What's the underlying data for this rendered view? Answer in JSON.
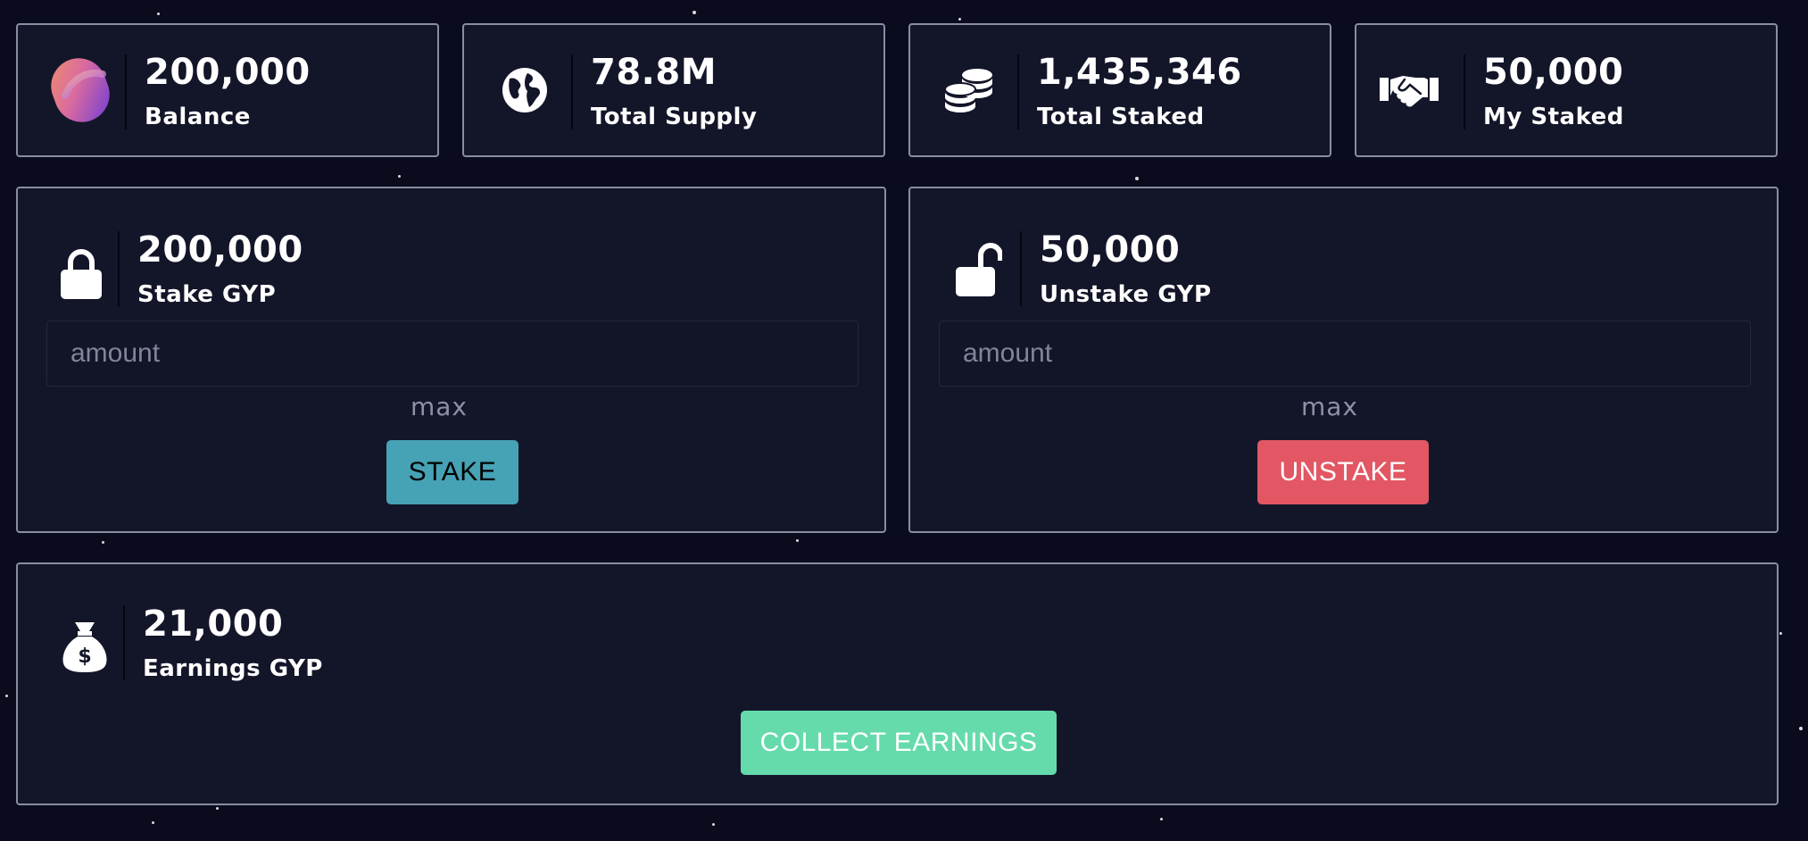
{
  "stats": [
    {
      "value": "200,000",
      "label": "Balance",
      "icon": "gradient-token-logo-icon"
    },
    {
      "value": "78.8M",
      "label": "Total Supply",
      "icon": "globe-icon"
    },
    {
      "value": "1,435,346",
      "label": "Total Staked",
      "icon": "coins-icon"
    },
    {
      "value": "50,000",
      "label": "My Staked",
      "icon": "handshake-icon"
    }
  ],
  "stake": {
    "value": "200,000",
    "label": "Stake GYP",
    "placeholder": "amount",
    "max_label": "max",
    "button_label": "STAKE",
    "icon": "lock-icon"
  },
  "unstake": {
    "value": "50,000",
    "label": "Unstake GYP",
    "placeholder": "amount",
    "max_label": "max",
    "button_label": "UNSTAKE",
    "icon": "unlock-icon"
  },
  "earnings": {
    "value": "21,000",
    "label": "Earnings GYP",
    "button_label": "COLLECT EARNINGS",
    "icon": "money-bag-icon"
  },
  "colors": {
    "background": "#0a0b1d",
    "panel": "#131629",
    "panel_border": "#8a8ca3",
    "stake_button": "#46a2b5",
    "unstake_button": "#e25763",
    "collect_button": "#65dbac"
  }
}
